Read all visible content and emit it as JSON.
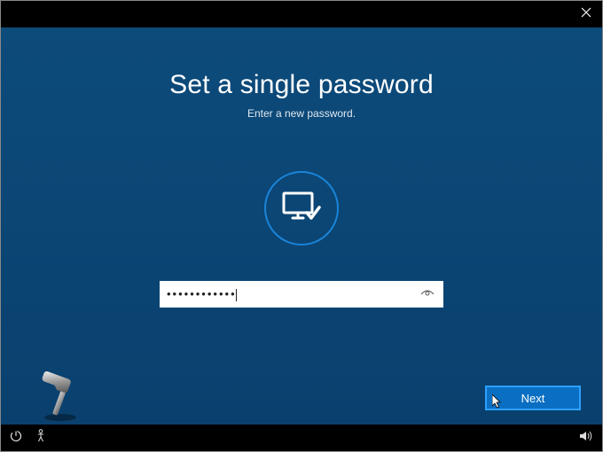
{
  "title": "Set a single password",
  "subtitle": "Enter a new password.",
  "password_value": "••••••••••••",
  "next_label": "Next",
  "icons": {
    "close": "close-icon",
    "monitor_check": "monitor-check-icon",
    "reveal": "eye-reveal-icon",
    "power": "power-icon",
    "accessibility": "accessibility-icon",
    "volume": "volume-icon",
    "hammer": "hammer-icon",
    "cursor": "cursor-icon"
  }
}
